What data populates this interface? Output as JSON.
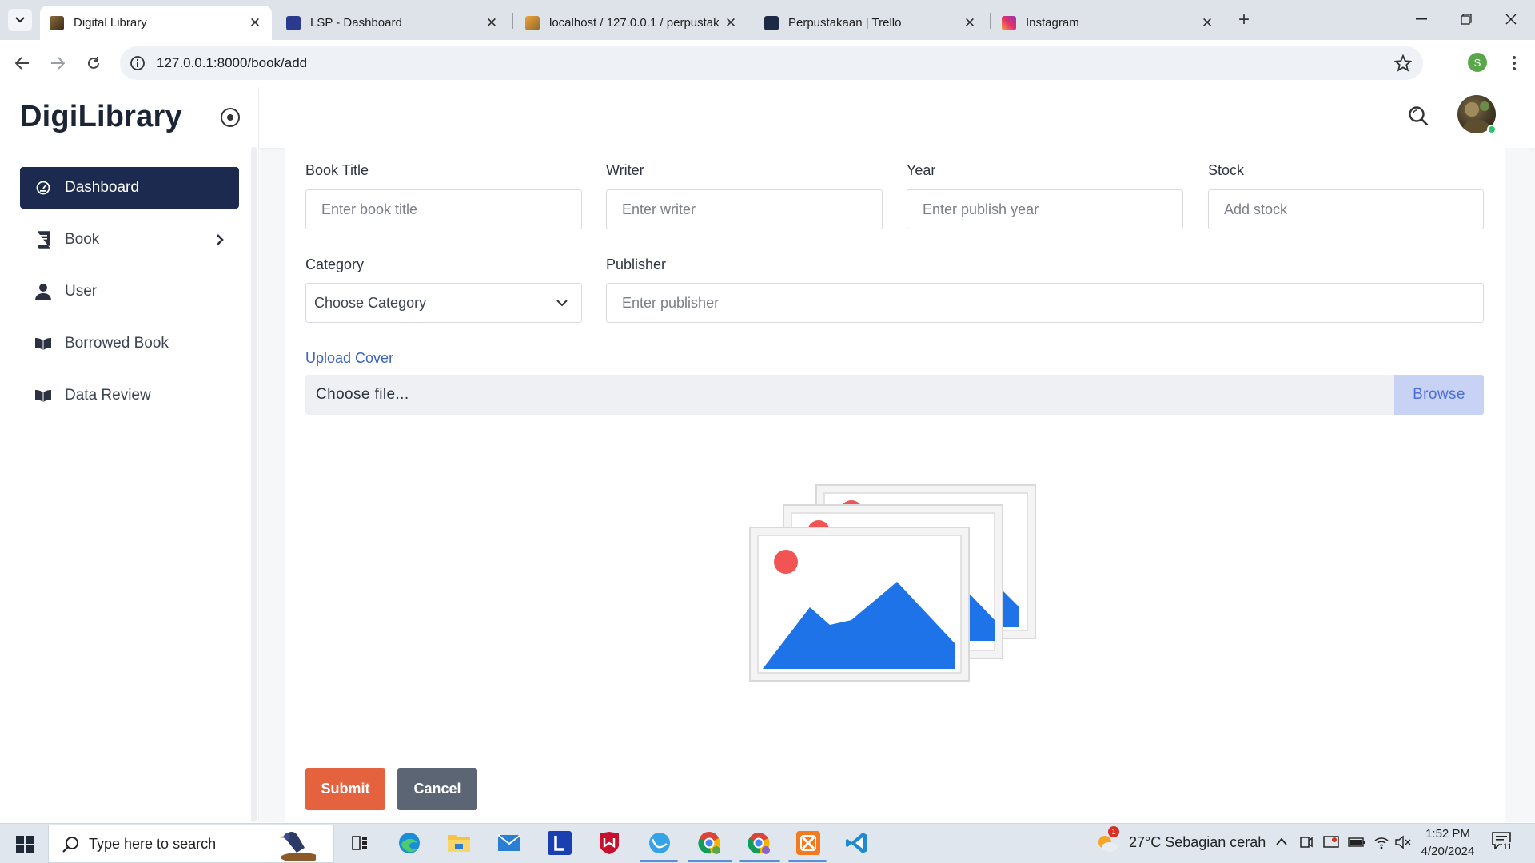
{
  "browser": {
    "tabs": [
      {
        "title": "Digital Library",
        "active": true
      },
      {
        "title": "LSP - Dashboard",
        "active": false
      },
      {
        "title": "localhost / 127.0.0.1 / perpustak",
        "active": false
      },
      {
        "title": "Perpustakaan | Trello",
        "active": false
      },
      {
        "title": "Instagram",
        "active": false
      }
    ],
    "url": "127.0.0.1:8000/book/add",
    "profile_initial": "S"
  },
  "sidebar": {
    "brand": "DigiLibrary",
    "items": [
      {
        "label": "Dashboard",
        "icon": "gauge-icon",
        "active": true
      },
      {
        "label": "Book",
        "icon": "book-icon",
        "active": false,
        "has_submenu": true
      },
      {
        "label": "User",
        "icon": "user-icon",
        "active": false
      },
      {
        "label": "Borrowed Book",
        "icon": "open-book-icon",
        "active": false
      },
      {
        "label": "Data Review",
        "icon": "open-book-icon",
        "active": false
      }
    ]
  },
  "form": {
    "book_title": {
      "label": "Book Title",
      "placeholder": "Enter book title"
    },
    "writer": {
      "label": "Writer",
      "placeholder": "Enter writer"
    },
    "year": {
      "label": "Year",
      "placeholder": "Enter publish year"
    },
    "stock": {
      "label": "Stock",
      "placeholder": "Add stock"
    },
    "category": {
      "label": "Category",
      "selected": "Choose Category"
    },
    "publisher": {
      "label": "Publisher",
      "placeholder": "Enter publisher"
    },
    "upload": {
      "label": "Upload Cover",
      "file_text": "Choose file...",
      "browse_label": "Browse"
    },
    "submit_label": "Submit",
    "cancel_label": "Cancel"
  },
  "taskbar": {
    "search_placeholder": "Type here to search",
    "weather": "27°C  Sebagian cerah",
    "time": "1:52 PM",
    "date": "4/20/2024",
    "notification_count": "11",
    "weather_badge": "1"
  },
  "colors": {
    "sidebar_active": "#1b2a4e",
    "submit": "#e5623f",
    "cancel": "#5c6573",
    "browse_bg": "#c7d2f5",
    "accent_blue": "#3a63c4"
  }
}
